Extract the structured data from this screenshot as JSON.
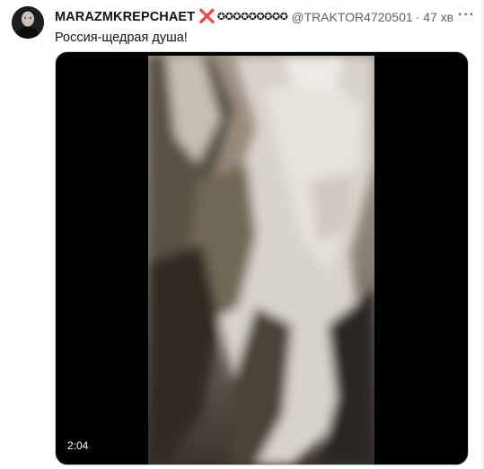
{
  "tweet": {
    "author_name": "MARAZMKREPCHAET",
    "cross_emoji": "❌",
    "badges": "✪✪✪✪✪✪✪✪✪",
    "handle": "@TRAKTOR4720501",
    "time": "· 47 хв",
    "more": "···",
    "text": "Россия-щедрая душа!",
    "video": {
      "duration": "2:04"
    }
  },
  "colors": {
    "cross": "#d4262c",
    "secondary_text": "#536471",
    "media_bg": "#000000"
  },
  "icons": {
    "avatar": "profile-photo",
    "more": "ellipsis-icon"
  }
}
